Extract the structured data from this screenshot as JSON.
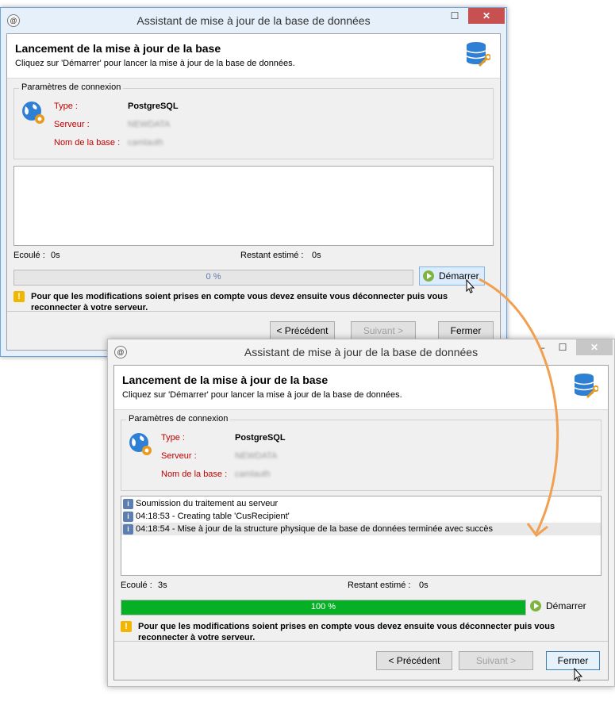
{
  "windows": [
    {
      "title": "Assistant de mise à jour de la base de données",
      "header_title": "Lancement de la mise à jour de la base",
      "header_subtitle": "Cliquez sur 'Démarrer' pour lancer la mise à jour de la base de données.",
      "group_title": "Paramètres de connexion",
      "type_label": "Type :",
      "type_value": "PostgreSQL",
      "server_label": "Serveur :",
      "server_value": "NEWDATA",
      "dbname_label": "Nom de la base :",
      "dbname_value": "camlauth",
      "log": [],
      "elapsed_label": "Ecoulé :",
      "elapsed_value": "0s",
      "remaining_label": "Restant estimé :",
      "remaining_value": "0s",
      "progress": 0,
      "progress_text": "0 %",
      "start_label": "Démarrer",
      "warning": "Pour que les modifications soient prises en compte vous devez ensuite vous déconnecter puis vous reconnecter à votre serveur.",
      "prev_label": "< Précédent",
      "next_label": "Suivant >",
      "close_label": "Fermer"
    },
    {
      "title": "Assistant de mise à jour de la base de données",
      "header_title": "Lancement de la mise à jour de la base",
      "header_subtitle": "Cliquez sur 'Démarrer' pour lancer la mise à jour de la base de données.",
      "group_title": "Paramètres de connexion",
      "type_label": "Type :",
      "type_value": "PostgreSQL",
      "server_label": "Serveur :",
      "server_value": "NEWDATA",
      "dbname_label": "Nom de la base :",
      "dbname_value": "camlauth",
      "log": [
        "Soumission du traitement au serveur",
        "04:18:53 - Creating table 'CusRecipient'",
        "04:18:54 - Mise à jour de la structure physique de la base de données terminée avec succès"
      ],
      "elapsed_label": "Ecoulé :",
      "elapsed_value": "3s",
      "remaining_label": "Restant estimé :",
      "remaining_value": "0s",
      "progress": 1.0,
      "progress_text": "100 %",
      "start_label": "Démarrer",
      "warning": "Pour que les modifications soient prises en compte vous devez ensuite vous déconnecter puis vous reconnecter à votre serveur.",
      "prev_label": "< Précédent",
      "next_label": "Suivant >",
      "close_label": "Fermer"
    }
  ],
  "colors": {
    "accent_arrow": "#f0a050",
    "progress_green": "#06b025",
    "label_red": "#c00000"
  }
}
